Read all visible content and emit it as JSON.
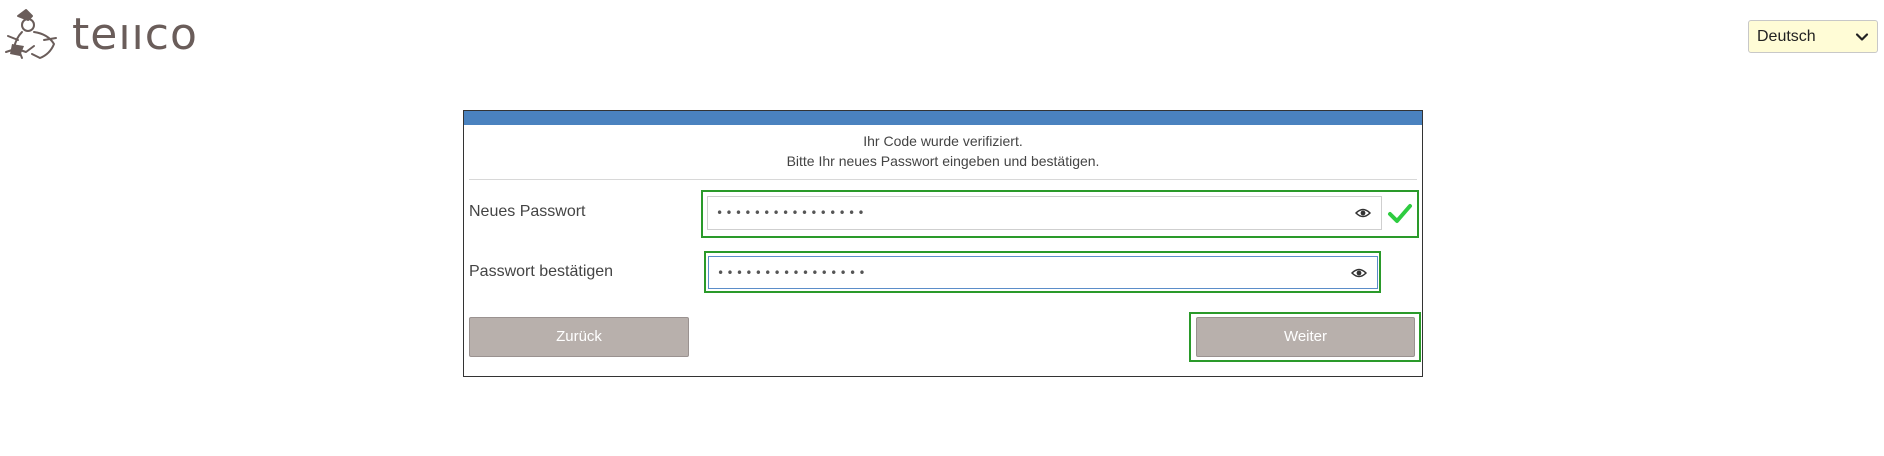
{
  "brand": {
    "logo_text": "teııco",
    "logo_icon": "mascot-logo-icon"
  },
  "language": {
    "selected": "Deutsch"
  },
  "panel": {
    "message_line1": "Ihr Code wurde verifiziert.",
    "message_line2": "Bitte Ihr neues Passwort eingeben und bestätigen.",
    "new_password": {
      "label": "Neues Passwort",
      "value_masked": "••••••••••••••••",
      "valid_icon": "check-icon",
      "toggle_icon": "eye-icon"
    },
    "confirm_password": {
      "label": "Passwort bestätigen",
      "value_masked": "••••••••••••••••",
      "toggle_icon": "eye-icon"
    },
    "back_label": "Zurück",
    "next_label": "Weiter"
  },
  "colors": {
    "accent_bar": "#4a82bf",
    "button_bg": "#b8b0ac",
    "valid_outline": "#2a9a2a",
    "check": "#2ecc40",
    "select_bg": "#fffcd6"
  }
}
